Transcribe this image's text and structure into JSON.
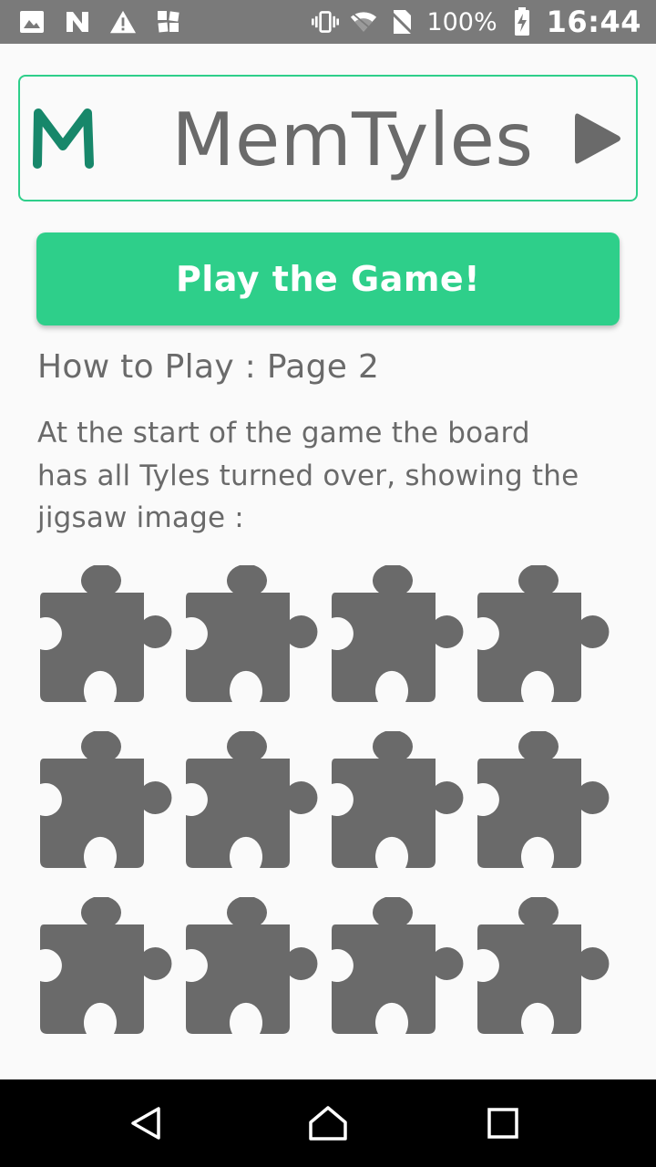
{
  "status_bar": {
    "left_icons": [
      "image-icon",
      "n-icon",
      "warning-icon",
      "scattered-squares-icon"
    ],
    "right_icons": [
      "vibrate-icon",
      "wifi-icon",
      "no-sim-icon"
    ],
    "battery": "100%",
    "time": "16:44"
  },
  "header": {
    "logo_letter": "M",
    "title": "MemTyles",
    "next_icon": "play-triangle-icon"
  },
  "play_button": {
    "label": "Play the Game!"
  },
  "howto": {
    "title": "How to Play : Page 2",
    "lines": [
      "At the start of the game the board",
      "has all Tyles turned over, showing the",
      "jigsaw image :"
    ]
  },
  "board": {
    "rows": 3,
    "cols": 4,
    "tile_icon": "jigsaw-piece-icon",
    "tile_color": "#6a6a6a"
  },
  "colors": {
    "accent": "#2ecf8a",
    "logo": "#17876a",
    "text_gray": "#6a6a6a",
    "status_bar": "#7a7a7a",
    "nav_bar": "#000000",
    "background": "#fafafa"
  },
  "nav_bar": {
    "back_icon": "back-triangle-icon",
    "home_icon": "home-icon",
    "recent_icon": "recent-apps-icon"
  }
}
